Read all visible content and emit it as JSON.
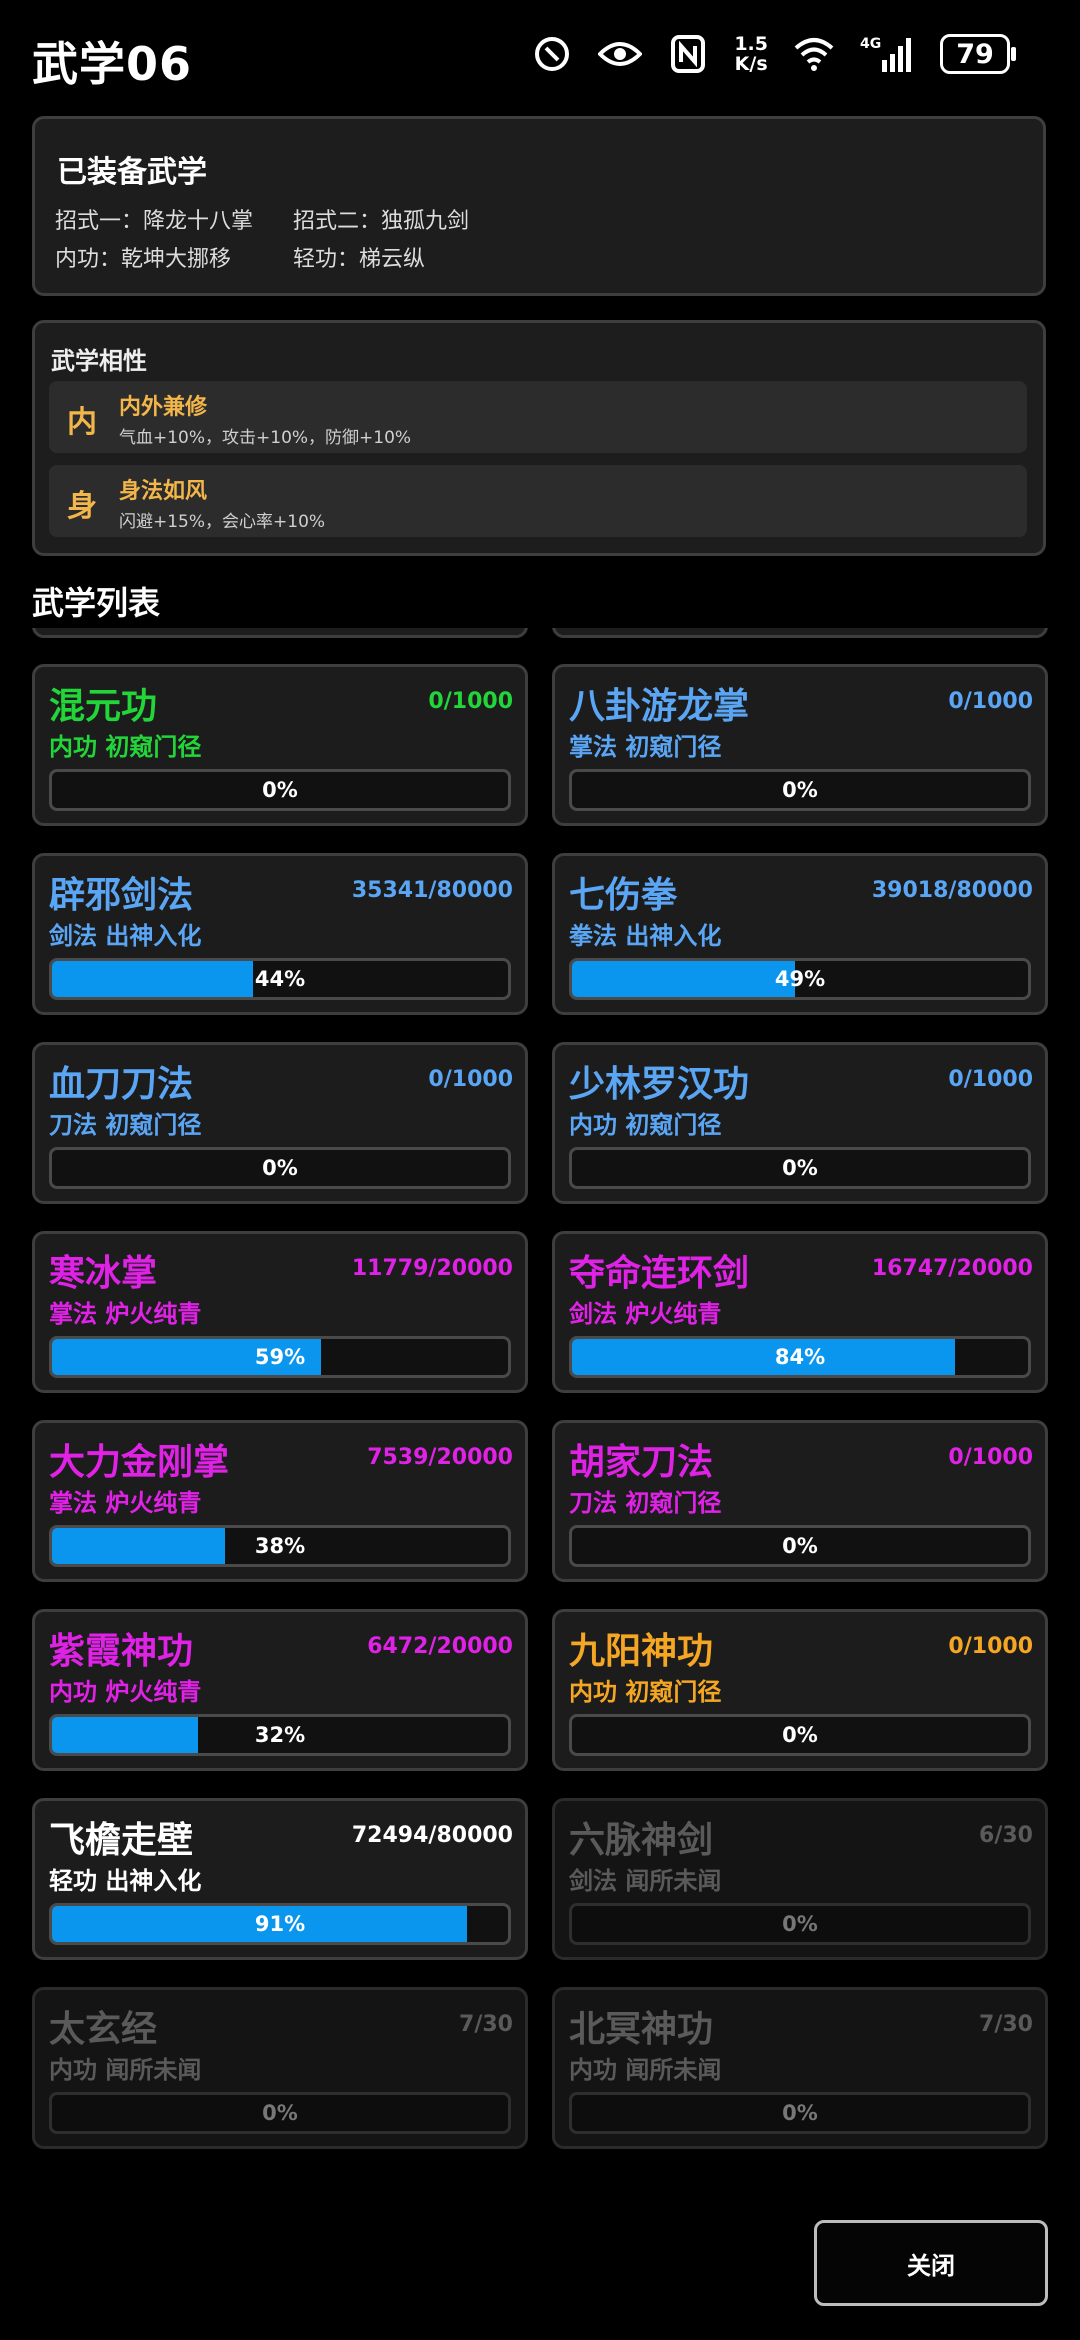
{
  "status_bar": {
    "title": "武学06",
    "net_speed": "1.5\nK/s",
    "net_type": "4G",
    "battery": "79"
  },
  "equipped": {
    "title": "已装备武学",
    "move1_label": "招式一：降龙十八掌",
    "move2_label": "招式二：独孤九剑",
    "inner_label": "内功：乾坤大挪移",
    "light_label": "轻功：梯云纵"
  },
  "affinity": {
    "title": "武学相性",
    "items": [
      {
        "char": "内",
        "name": "内外兼修",
        "desc": "气血+10%，攻击+10%，防御+10%"
      },
      {
        "char": "身",
        "name": "身法如风",
        "desc": "闪避+15%，会心率+10%"
      }
    ]
  },
  "list": {
    "title": "武学列表",
    "skills": [
      {
        "name": "混元功",
        "progress": "0/1000",
        "info": "内功 初窥门径",
        "percent": "0%",
        "fill": 0,
        "color": "#22d63a",
        "dim": false
      },
      {
        "name": "八卦游龙掌",
        "progress": "0/1000",
        "info": "掌法 初窥门径",
        "percent": "0%",
        "fill": 0,
        "color": "#5aa6f5",
        "dim": false
      },
      {
        "name": "辟邪剑法",
        "progress": "35341/80000",
        "info": "剑法 出神入化",
        "percent": "44%",
        "fill": 44,
        "color": "#5aa6f5",
        "dim": false
      },
      {
        "name": "七伤拳",
        "progress": "39018/80000",
        "info": "拳法 出神入化",
        "percent": "49%",
        "fill": 49,
        "color": "#5aa6f5",
        "dim": false
      },
      {
        "name": "血刀刀法",
        "progress": "0/1000",
        "info": "刀法 初窥门径",
        "percent": "0%",
        "fill": 0,
        "color": "#5aa6f5",
        "dim": false
      },
      {
        "name": "少林罗汉功",
        "progress": "0/1000",
        "info": "内功 初窥门径",
        "percent": "0%",
        "fill": 0,
        "color": "#5aa6f5",
        "dim": false
      },
      {
        "name": "寒冰掌",
        "progress": "11779/20000",
        "info": "掌法 炉火纯青",
        "percent": "59%",
        "fill": 59,
        "color": "#e022e6",
        "dim": false
      },
      {
        "name": "夺命连环剑",
        "progress": "16747/20000",
        "info": "剑法 炉火纯青",
        "percent": "84%",
        "fill": 84,
        "color": "#e022e6",
        "dim": false
      },
      {
        "name": "大力金刚掌",
        "progress": "7539/20000",
        "info": "掌法 炉火纯青",
        "percent": "38%",
        "fill": 38,
        "color": "#e022e6",
        "dim": false
      },
      {
        "name": "胡家刀法",
        "progress": "0/1000",
        "info": "刀法 初窥门径",
        "percent": "0%",
        "fill": 0,
        "color": "#e022e6",
        "dim": false
      },
      {
        "name": "紫霞神功",
        "progress": "6472/20000",
        "info": "内功 炉火纯青",
        "percent": "32%",
        "fill": 32,
        "color": "#e022e6",
        "dim": false
      },
      {
        "name": "九阳神功",
        "progress": "0/1000",
        "info": "内功 初窥门径",
        "percent": "0%",
        "fill": 0,
        "color": "#f5a623",
        "dim": false
      },
      {
        "name": "飞檐走壁",
        "progress": "72494/80000",
        "info": "轻功 出神入化",
        "percent": "91%",
        "fill": 91,
        "color": "#ffffff",
        "dim": false
      },
      {
        "name": "六脉神剑",
        "progress": "6/30",
        "info": "剑法 闻所未闻",
        "percent": "0%",
        "fill": 0,
        "color": "#5a5a5a",
        "dim": true
      },
      {
        "name": "太玄经",
        "progress": "7/30",
        "info": "内功 闻所未闻",
        "percent": "0%",
        "fill": 0,
        "color": "#5a5a5a",
        "dim": true
      },
      {
        "name": "北冥神功",
        "progress": "7/30",
        "info": "内功 闻所未闻",
        "percent": "0%",
        "fill": 0,
        "color": "#5a5a5a",
        "dim": true
      }
    ]
  },
  "close_label": "关闭"
}
